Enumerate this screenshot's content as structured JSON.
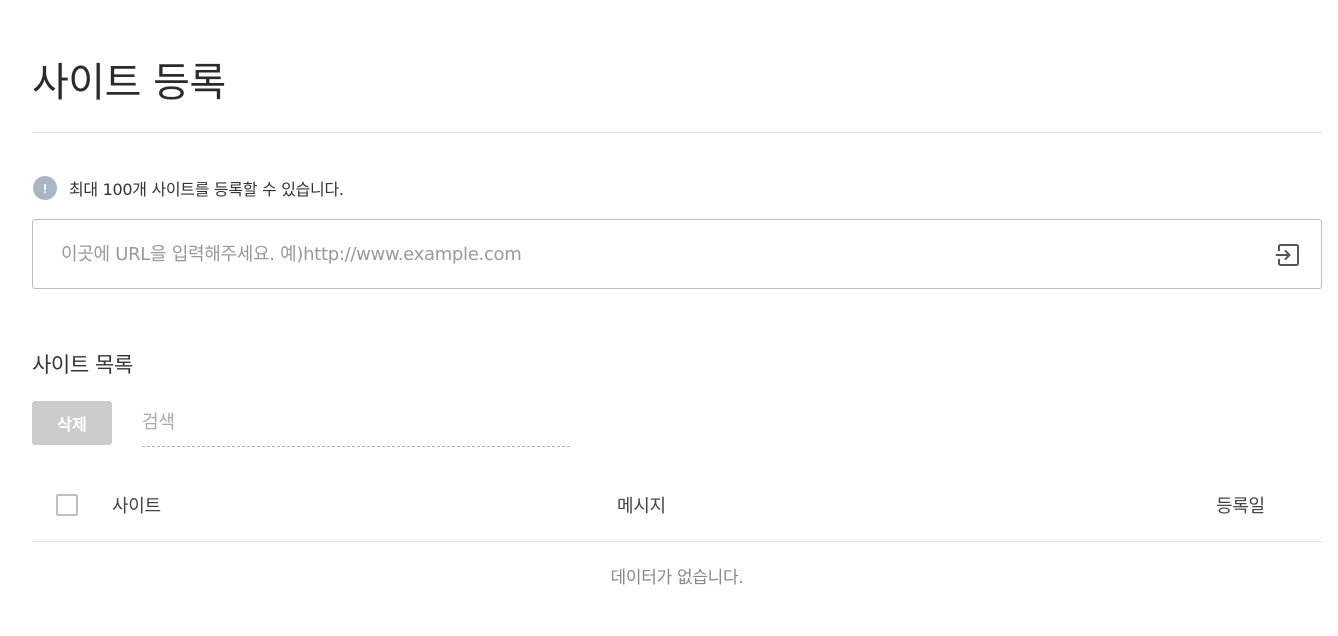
{
  "page": {
    "title": "사이트 등록"
  },
  "notice": {
    "icon": "exclamation-icon",
    "icon_glyph": "!",
    "text": "최대 100개 사이트를 등록할 수 있습니다."
  },
  "url_field": {
    "placeholder": "이곳에 URL을 입력해주세요. 예)http://www.example.com",
    "value": "",
    "submit_icon": "enter-icon"
  },
  "site_list": {
    "title": "사이트 목록",
    "delete_label": "삭제",
    "search_placeholder": "검색",
    "search_value": "",
    "columns": {
      "site": "사이트",
      "message": "메시지",
      "date": "등록일"
    },
    "select_all_checked": false,
    "rows": [],
    "empty_text": "데이터가 없습니다."
  },
  "colors": {
    "delete_button_bg": "#cccccc",
    "info_icon_bg": "#a9b6c3",
    "border": "#bdbdbd",
    "divider": "#e3e3e3"
  }
}
